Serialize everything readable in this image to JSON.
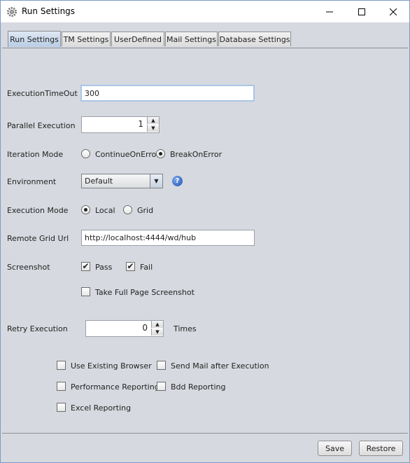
{
  "window": {
    "title": "Run Settings",
    "minimize_icon": "minimize-icon",
    "maximize_icon": "maximize-icon",
    "close_icon": "close-icon",
    "app_icon": "gear-icon"
  },
  "tabs": [
    {
      "label": "Run Settings",
      "active": true
    },
    {
      "label": "TM Settings",
      "active": false
    },
    {
      "label": "UserDefined",
      "active": false
    },
    {
      "label": "Mail Settings",
      "active": false
    },
    {
      "label": "Database Settings",
      "active": false
    }
  ],
  "form": {
    "execution_timeout": {
      "label": "ExecutionTimeOut",
      "value": "300"
    },
    "parallel_execution": {
      "label": "Parallel Execution",
      "value": "1"
    },
    "iteration_mode": {
      "label": "Iteration Mode",
      "options": [
        "ContinueOnError",
        "BreakOnError"
      ],
      "selected": "BreakOnError"
    },
    "environment": {
      "label": "Environment",
      "value": "Default",
      "help_icon": "help-icon"
    },
    "execution_mode": {
      "label": "Execution Mode",
      "options": [
        "Local",
        "Grid"
      ],
      "selected": "Local"
    },
    "remote_grid_url": {
      "label": "Remote Grid Url",
      "value": "http://localhost:4444/wd/hub"
    },
    "screenshot": {
      "label": "Screenshot",
      "pass": {
        "label": "Pass",
        "checked": true
      },
      "fail": {
        "label": "Fail",
        "checked": true
      },
      "full_page": {
        "label": "Take Full Page Screenshot",
        "checked": false
      }
    },
    "retry_execution": {
      "label": "Retry Execution",
      "value": "0",
      "suffix": "Times"
    },
    "options": {
      "use_existing_browser": {
        "label": "Use Existing Browser",
        "checked": false
      },
      "send_mail": {
        "label": "Send Mail after Execution",
        "checked": false
      },
      "performance_reporting": {
        "label": "Performance Reporting",
        "checked": false
      },
      "bdd_reporting": {
        "label": "Bdd Reporting",
        "checked": false
      },
      "excel_reporting": {
        "label": "Excel Reporting",
        "checked": false
      }
    }
  },
  "footer": {
    "save_label": "Save",
    "restore_label": "Restore"
  },
  "checkmark": "✔"
}
